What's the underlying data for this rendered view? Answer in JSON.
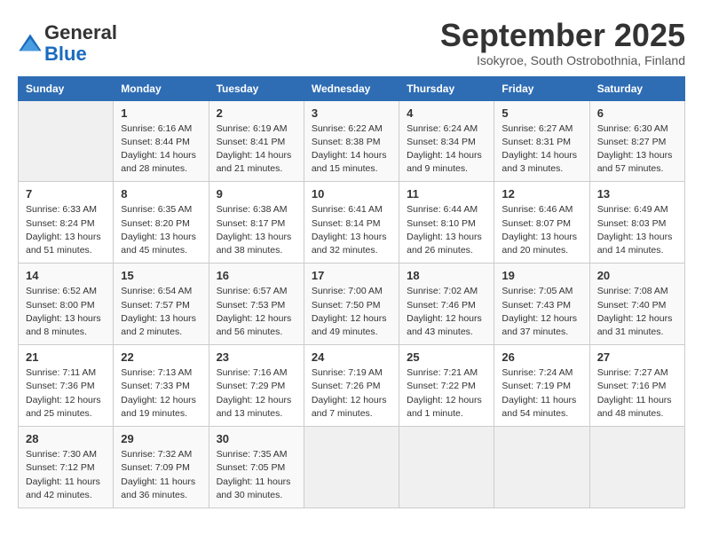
{
  "header": {
    "logo_general": "General",
    "logo_blue": "Blue",
    "month_title": "September 2025",
    "subtitle": "Isokyroe, South Ostrobothnia, Finland"
  },
  "weekdays": [
    "Sunday",
    "Monday",
    "Tuesday",
    "Wednesday",
    "Thursday",
    "Friday",
    "Saturday"
  ],
  "weeks": [
    [
      {
        "day": "",
        "info": ""
      },
      {
        "day": "1",
        "info": "Sunrise: 6:16 AM\nSunset: 8:44 PM\nDaylight: 14 hours\nand 28 minutes."
      },
      {
        "day": "2",
        "info": "Sunrise: 6:19 AM\nSunset: 8:41 PM\nDaylight: 14 hours\nand 21 minutes."
      },
      {
        "day": "3",
        "info": "Sunrise: 6:22 AM\nSunset: 8:38 PM\nDaylight: 14 hours\nand 15 minutes."
      },
      {
        "day": "4",
        "info": "Sunrise: 6:24 AM\nSunset: 8:34 PM\nDaylight: 14 hours\nand 9 minutes."
      },
      {
        "day": "5",
        "info": "Sunrise: 6:27 AM\nSunset: 8:31 PM\nDaylight: 14 hours\nand 3 minutes."
      },
      {
        "day": "6",
        "info": "Sunrise: 6:30 AM\nSunset: 8:27 PM\nDaylight: 13 hours\nand 57 minutes."
      }
    ],
    [
      {
        "day": "7",
        "info": "Sunrise: 6:33 AM\nSunset: 8:24 PM\nDaylight: 13 hours\nand 51 minutes."
      },
      {
        "day": "8",
        "info": "Sunrise: 6:35 AM\nSunset: 8:20 PM\nDaylight: 13 hours\nand 45 minutes."
      },
      {
        "day": "9",
        "info": "Sunrise: 6:38 AM\nSunset: 8:17 PM\nDaylight: 13 hours\nand 38 minutes."
      },
      {
        "day": "10",
        "info": "Sunrise: 6:41 AM\nSunset: 8:14 PM\nDaylight: 13 hours\nand 32 minutes."
      },
      {
        "day": "11",
        "info": "Sunrise: 6:44 AM\nSunset: 8:10 PM\nDaylight: 13 hours\nand 26 minutes."
      },
      {
        "day": "12",
        "info": "Sunrise: 6:46 AM\nSunset: 8:07 PM\nDaylight: 13 hours\nand 20 minutes."
      },
      {
        "day": "13",
        "info": "Sunrise: 6:49 AM\nSunset: 8:03 PM\nDaylight: 13 hours\nand 14 minutes."
      }
    ],
    [
      {
        "day": "14",
        "info": "Sunrise: 6:52 AM\nSunset: 8:00 PM\nDaylight: 13 hours\nand 8 minutes."
      },
      {
        "day": "15",
        "info": "Sunrise: 6:54 AM\nSunset: 7:57 PM\nDaylight: 13 hours\nand 2 minutes."
      },
      {
        "day": "16",
        "info": "Sunrise: 6:57 AM\nSunset: 7:53 PM\nDaylight: 12 hours\nand 56 minutes."
      },
      {
        "day": "17",
        "info": "Sunrise: 7:00 AM\nSunset: 7:50 PM\nDaylight: 12 hours\nand 49 minutes."
      },
      {
        "day": "18",
        "info": "Sunrise: 7:02 AM\nSunset: 7:46 PM\nDaylight: 12 hours\nand 43 minutes."
      },
      {
        "day": "19",
        "info": "Sunrise: 7:05 AM\nSunset: 7:43 PM\nDaylight: 12 hours\nand 37 minutes."
      },
      {
        "day": "20",
        "info": "Sunrise: 7:08 AM\nSunset: 7:40 PM\nDaylight: 12 hours\nand 31 minutes."
      }
    ],
    [
      {
        "day": "21",
        "info": "Sunrise: 7:11 AM\nSunset: 7:36 PM\nDaylight: 12 hours\nand 25 minutes."
      },
      {
        "day": "22",
        "info": "Sunrise: 7:13 AM\nSunset: 7:33 PM\nDaylight: 12 hours\nand 19 minutes."
      },
      {
        "day": "23",
        "info": "Sunrise: 7:16 AM\nSunset: 7:29 PM\nDaylight: 12 hours\nand 13 minutes."
      },
      {
        "day": "24",
        "info": "Sunrise: 7:19 AM\nSunset: 7:26 PM\nDaylight: 12 hours\nand 7 minutes."
      },
      {
        "day": "25",
        "info": "Sunrise: 7:21 AM\nSunset: 7:22 PM\nDaylight: 12 hours\nand 1 minute."
      },
      {
        "day": "26",
        "info": "Sunrise: 7:24 AM\nSunset: 7:19 PM\nDaylight: 11 hours\nand 54 minutes."
      },
      {
        "day": "27",
        "info": "Sunrise: 7:27 AM\nSunset: 7:16 PM\nDaylight: 11 hours\nand 48 minutes."
      }
    ],
    [
      {
        "day": "28",
        "info": "Sunrise: 7:30 AM\nSunset: 7:12 PM\nDaylight: 11 hours\nand 42 minutes."
      },
      {
        "day": "29",
        "info": "Sunrise: 7:32 AM\nSunset: 7:09 PM\nDaylight: 11 hours\nand 36 minutes."
      },
      {
        "day": "30",
        "info": "Sunrise: 7:35 AM\nSunset: 7:05 PM\nDaylight: 11 hours\nand 30 minutes."
      },
      {
        "day": "",
        "info": ""
      },
      {
        "day": "",
        "info": ""
      },
      {
        "day": "",
        "info": ""
      },
      {
        "day": "",
        "info": ""
      }
    ]
  ]
}
